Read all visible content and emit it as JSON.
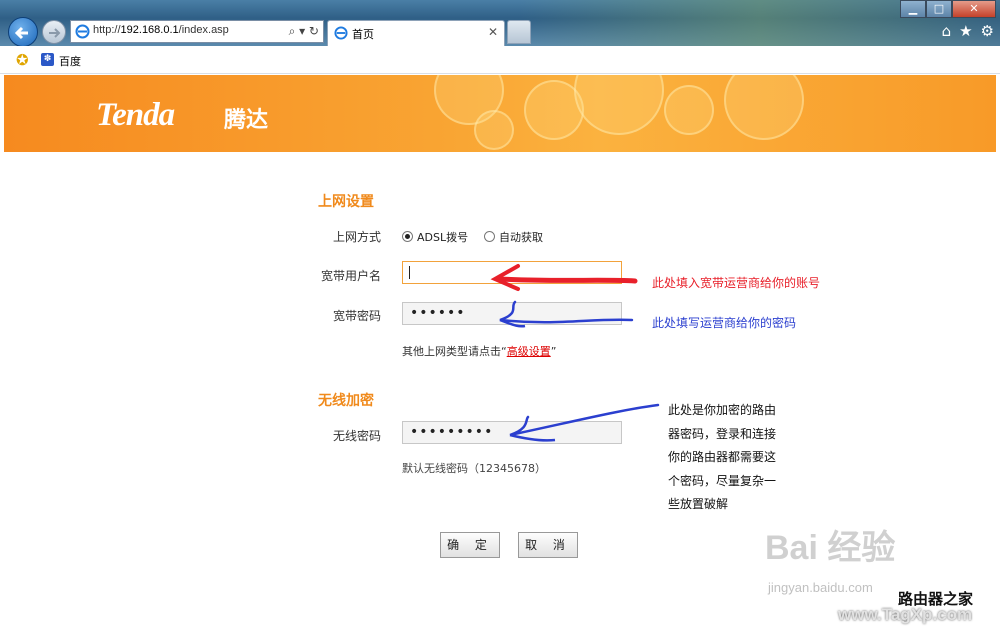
{
  "browser": {
    "url_prefix": "http://",
    "url_host": "192.168.0.1",
    "url_path": "/index.asp",
    "tab_title": "首页",
    "favorites": [
      {
        "label": "百度"
      }
    ]
  },
  "router": {
    "brand": "Tenda",
    "brand_cn": "腾达",
    "internet_section_title": "上网设置",
    "connection_mode_label": "上网方式",
    "mode_options": [
      {
        "label": "ADSL拨号",
        "selected": true
      },
      {
        "label": "自动获取",
        "selected": false
      }
    ],
    "username_label": "宽带用户名",
    "username_value": "",
    "password_label": "宽带密码",
    "password_mask": "••••••",
    "other_types_text": "其他上网类型请点击“",
    "advanced_link": "高级设置",
    "other_types_close": "”",
    "wireless_section_title": "无线加密",
    "wireless_password_label": "无线密码",
    "wireless_password_mask": "•••••••••",
    "default_password_note": "默认无线密码（12345678）",
    "confirm_button": "确 定",
    "cancel_button": "取 消"
  },
  "annotations": {
    "username_note": "此处填入宽带运营商给你的账号",
    "password_note": "此处填写运营商给你的密码",
    "wireless_note": [
      "此处是你加密的路由",
      "器密码，登录和连接",
      "你的路由器都需要这",
      "个密码，尽量复杂一",
      "些放置破解"
    ]
  },
  "watermarks": {
    "baidu": "Bai 经验",
    "jingyan": "jingyan.baidu.com",
    "site_cn": "路由器之家",
    "site_en": "www.TagXp.com"
  },
  "colors": {
    "accent_orange": "#f08a1c",
    "annotation_red": "#e8202a",
    "annotation_blue": "#2b3fcf"
  }
}
